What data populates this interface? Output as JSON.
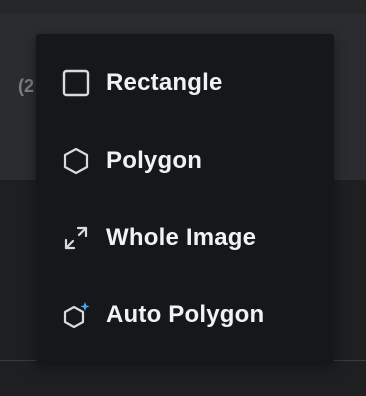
{
  "background": {
    "partial_text": "(2"
  },
  "menu": {
    "items": [
      {
        "label": "Rectangle",
        "icon": "rectangle-icon"
      },
      {
        "label": "Polygon",
        "icon": "hexagon-icon"
      },
      {
        "label": "Whole Image",
        "icon": "expand-diagonal-icon"
      },
      {
        "label": "Auto Polygon",
        "icon": "auto-polygon-icon"
      }
    ]
  },
  "colors": {
    "menu_background": "#16171a",
    "text": "#f1f2f4",
    "icon_stroke": "#d9dadd",
    "accent": "#3fa9f5"
  }
}
